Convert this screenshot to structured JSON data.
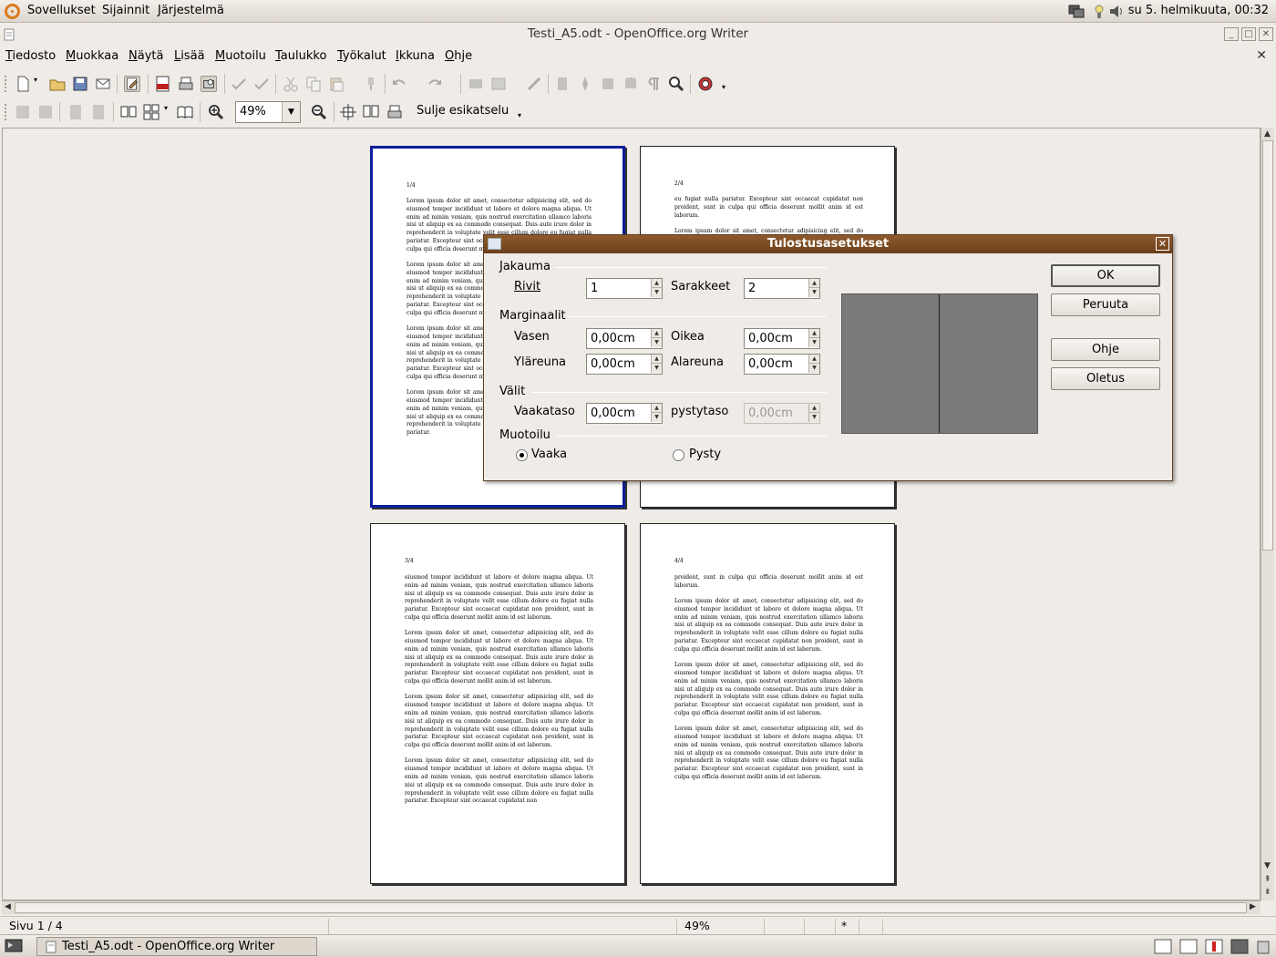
{
  "top_panel": {
    "menus": [
      "Sovellukset",
      "Sijainnit",
      "Järjestelmä"
    ],
    "clock": "su  5. helmikuuta, 00:32"
  },
  "window": {
    "title": "Testi_A5.odt - OpenOffice.org Writer",
    "controls": {
      "minimize": "_",
      "maximize": "□",
      "close": "✕"
    }
  },
  "menubar": {
    "items": [
      "Tiedosto",
      "Muokkaa",
      "Näytä",
      "Lisää",
      "Muotoilu",
      "Taulukko",
      "Työkalut",
      "Ikkuna",
      "Ohje"
    ],
    "close_doc": "✕"
  },
  "preview_toolbar": {
    "zoom_value": "49%",
    "close_preview_label": "Sulje esikatselu"
  },
  "pages": [
    {
      "number": "1/4",
      "paragraphs": [
        "Lorem ipsum dolor sit amet, consectetur adipisicing elit, sed do eiusmod tempor incididunt ut labore et dolore magna aliqua. Ut enim ad minim veniam, quis nostrud exercitation ullamco laboris nisi ut aliquip ex ea commodo consequat. Duis aute irure dolor in reprehenderit in voluptate velit esse cillum dolore eu fugiat nulla pariatur. Excepteur sint occaecat cupidatat non proident, sunt in culpa qui officia deserunt mollit anim id est laborum.",
        "Lorem ipsum dolor sit amet, consectetur adipisicing elit, sed do eiusmod tempor incididunt ut labore et dolore magna aliqua. Ut enim ad minim veniam, quis nostrud exercitation ullamco laboris nisi ut aliquip ex ea commodo consequat. Duis aute irure dolor in reprehenderit in voluptate velit esse cillum dolore eu fugiat nulla pariatur. Excepteur sint occaecat cupidatat non proident, sunt in culpa qui officia deserunt mollit anim id est laborum.",
        "Lorem ipsum dolor sit amet, consectetur adipisicing elit, sed do eiusmod tempor incididunt ut labore et dolore magna aliqua. Ut enim ad minim veniam, quis nostrud exercitation ullamco laboris nisi ut aliquip ex ea commodo consequat. Duis aute irure dolor in reprehenderit in voluptate velit esse cillum dolore eu fugiat nulla pariatur. Excepteur sint occaecat cupidatat non proident, sunt in culpa qui officia deserunt mollit anim id est laborum.",
        "Lorem ipsum dolor sit amet, consectetur adipisicing elit, sed do eiusmod tempor incididunt ut labore et dolore magna aliqua. Ut enim ad minim veniam, quis nostrud exercitation ullamco laboris nisi ut aliquip ex ea commodo consequat. Duis aute irure dolor in reprehenderit in voluptate velit esse cillum dolore eu fugiat nulla pariatur."
      ]
    },
    {
      "number": "2/4",
      "paragraphs": [
        "eu fugiat nulla pariatur. Excepteur sint occaecat cupidatat non proident, sunt in culpa qui officia deserunt mollit anim id est laborum.",
        "Lorem ipsum dolor sit amet, consectetur adipisicing elit, sed do eiusmod tempor incididunt ut labore et dolore magna aliqua."
      ]
    },
    {
      "number": "3/4",
      "paragraphs": [
        "eiusmod tempor incididunt ut labore et dolore magna aliqua. Ut enim ad minim veniam, quis nostrud exercitation ullamco laboris nisi ut aliquip ex ea commodo consequat. Duis aute irure dolor in reprehenderit in voluptate velit esse cillum dolore eu fugiat nulla pariatur. Excepteur sint occaecat cupidatat non proident, sunt in culpa qui officia deserunt mollit anim id est laborum.",
        "Lorem ipsum dolor sit amet, consectetur adipisicing elit, sed do eiusmod tempor incididunt ut labore et dolore magna aliqua. Ut enim ad minim veniam, quis nostrud exercitation ullamco laboris nisi ut aliquip ex ea commodo consequat. Duis aute irure dolor in reprehenderit in voluptate velit esse cillum dolore eu fugiat nulla pariatur. Excepteur sint occaecat cupidatat non proident, sunt in culpa qui officia deserunt mollit anim id est laborum.",
        "Lorem ipsum dolor sit amet, consectetur adipisicing elit, sed do eiusmod tempor incididunt ut labore et dolore magna aliqua. Ut enim ad minim veniam, quis nostrud exercitation ullamco laboris nisi ut aliquip ex ea commodo consequat. Duis aute irure dolor in reprehenderit in voluptate velit esse cillum dolore eu fugiat nulla pariatur. Excepteur sint occaecat cupidatat non proident, sunt in culpa qui officia deserunt mollit anim id est laborum.",
        "Lorem ipsum dolor sit amet, consectetur adipisicing elit, sed do eiusmod tempor incididunt ut labore et dolore magna aliqua. Ut enim ad minim veniam, quis nostrud exercitation ullamco laboris nisi ut aliquip ex ea commodo consequat. Duis aute irure dolor in reprehenderit in voluptate velit esse cillum dolore eu fugiat nulla pariatur. Excepteur sint occaecat cupidatat non"
      ]
    },
    {
      "number": "4/4",
      "paragraphs": [
        "proident, sunt in culpa qui officia deserunt mollit anim id est laborum.",
        "Lorem ipsum dolor sit amet, consectetur adipisicing elit, sed do eiusmod tempor incididunt ut labore et dolore magna aliqua. Ut enim ad minim veniam, quis nostrud exercitation ullamco laboris nisi ut aliquip ex ea commodo consequat. Duis aute irure dolor in reprehenderit in voluptate velit esse cillum dolore eu fugiat nulla pariatur. Excepteur sint occaecat cupidatat non proident, sunt in culpa qui officia deserunt mollit anim id est laborum.",
        "Lorem ipsum dolor sit amet, consectetur adipisicing elit, sed do eiusmod tempor incididunt ut labore et dolore magna aliqua. Ut enim ad minim veniam, quis nostrud exercitation ullamco laboris nisi ut aliquip ex ea commodo consequat. Duis aute irure dolor in reprehenderit in voluptate velit esse cillum dolore eu fugiat nulla pariatur. Excepteur sint occaecat cupidatat non proident, sunt in culpa qui officia deserunt mollit anim id est laborum.",
        "Lorem ipsum dolor sit amet, consectetur adipisicing elit, sed do eiusmod tempor incididunt ut labore et dolore magna aliqua. Ut enim ad minim veniam, quis nostrud exercitation ullamco laboris nisi ut aliquip ex ea commodo consequat. Duis aute irure dolor in reprehenderit in voluptate velit esse cillum dolore eu fugiat nulla pariatur. Excepteur sint occaecat cupidatat non proident, sunt in culpa qui officia deserunt mollit anim id est laborum."
      ]
    }
  ],
  "dialog": {
    "title": "Tulostusasetukset",
    "close": "✕",
    "distribution": {
      "heading": "Jakauma",
      "rows_label": "Rivit",
      "rows_value": "1",
      "columns_label": "Sarakkeet",
      "columns_value": "2"
    },
    "margins": {
      "heading": "Marginaalit",
      "left_label": "Vasen",
      "left_value": "0,00cm",
      "right_label": "Oikea",
      "right_value": "0,00cm",
      "top_label": "Yläreuna",
      "top_value": "0,00cm",
      "bottom_label": "Alareuna",
      "bottom_value": "0,00cm"
    },
    "spacing": {
      "heading": "Välit",
      "horizontal_label": "Vaakataso",
      "horizontal_value": "0,00cm",
      "vertical_label": "pystytaso",
      "vertical_value": "0,00cm"
    },
    "format": {
      "heading": "Muotoilu",
      "landscape_label": "Vaaka",
      "portrait_label": "Pysty",
      "selected": "Vaaka"
    },
    "buttons": {
      "ok": "OK",
      "cancel": "Peruuta",
      "help": "Ohje",
      "default": "Oletus"
    },
    "preview_color": "#7a7a7a"
  },
  "statusbar": {
    "page": "Sivu 1 / 4",
    "zoom": "49%",
    "insert_mode": "*"
  },
  "taskbar": {
    "task_label": "Testi_A5.odt - OpenOffice.org Writer"
  },
  "colors": {
    "selected_page_border": "#0c1d9d",
    "dialog_titlebar": "#7e4c23",
    "accent_orange": "#dd7a1e"
  }
}
